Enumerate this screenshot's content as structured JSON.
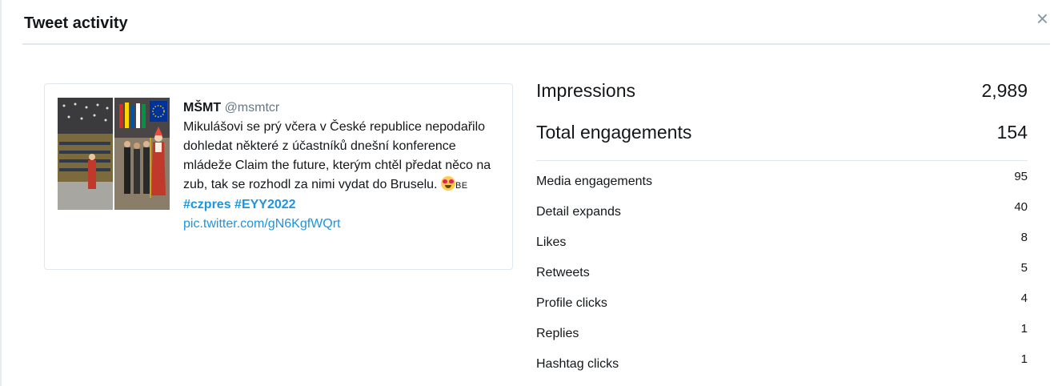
{
  "dialog": {
    "title": "Tweet activity",
    "close_icon": "close-icon",
    "close_glyph": "×"
  },
  "tweet": {
    "author_name": "MŠMT",
    "author_handle": "@msmtcr",
    "text": "Mikulášovi se prý včera v České republice nepodařilo dohledat některé z účastníků dnešní konference mládeže Claim the future, kterým chtěl předat něco na zub, tak se rozhodl za nimi vydat do Bruselu.",
    "emoji_icon": "star-struck-emoji-icon",
    "flag_code": "BE",
    "hashtags": [
      "#czpres",
      "#EYY2022"
    ],
    "pic_link": "pic.twitter.com/gN6KgfWQrt"
  },
  "stats": {
    "impressions": {
      "label": "Impressions",
      "value": "2,989"
    },
    "total_engagements": {
      "label": "Total engagements",
      "value": "154"
    },
    "breakdown": [
      {
        "label": "Media engagements",
        "value": "95"
      },
      {
        "label": "Detail expands",
        "value": "40"
      },
      {
        "label": "Likes",
        "value": "8"
      },
      {
        "label": "Retweets",
        "value": "5"
      },
      {
        "label": "Profile clicks",
        "value": "4"
      },
      {
        "label": "Replies",
        "value": "1"
      },
      {
        "label": "Hashtag clicks",
        "value": "1"
      }
    ]
  },
  "colors": {
    "link": "#1b95e0",
    "handle": "#657786",
    "border": "#e1e8ed"
  }
}
